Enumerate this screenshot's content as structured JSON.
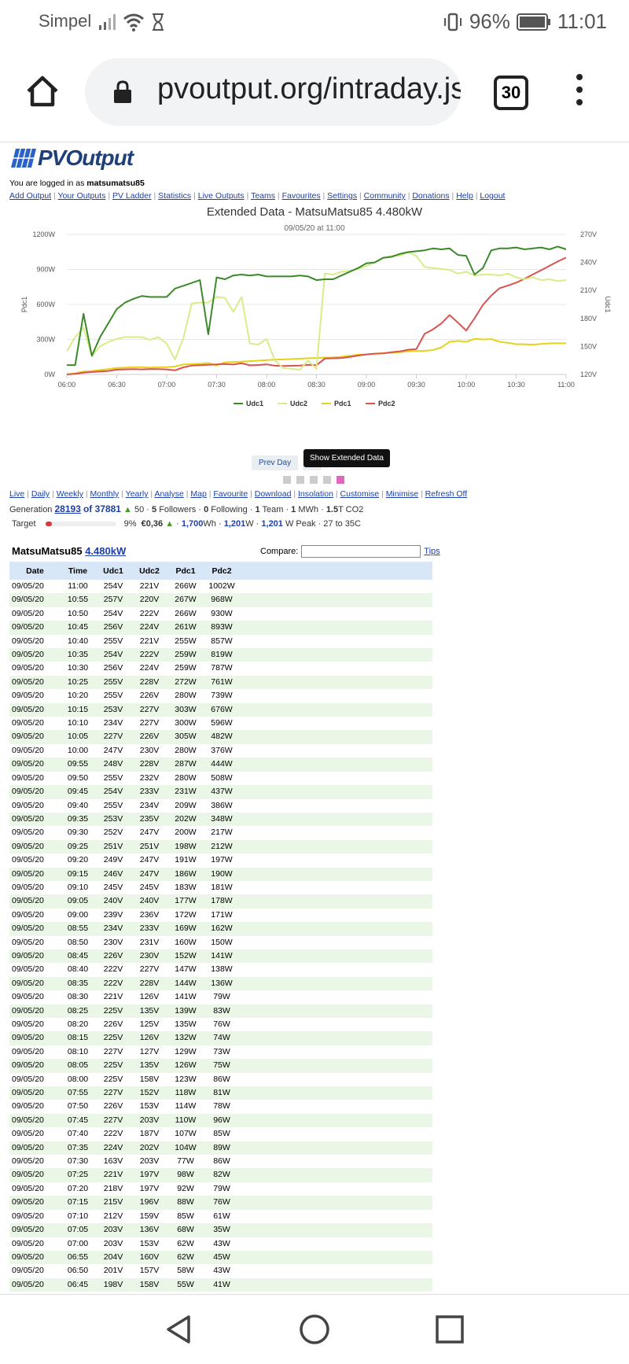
{
  "status": {
    "carrier": "Simpel",
    "battery": "96%",
    "time": "11:01"
  },
  "browser": {
    "url": "pvoutput.org/intraday.js",
    "tab_count": "30"
  },
  "site": {
    "logo": "PVOutput",
    "login_prefix": "You are logged in as",
    "username": "matsumatsu85",
    "nav": [
      "Add Output",
      "Your Outputs",
      "PV Ladder",
      "Statistics",
      "Live Outputs",
      "Teams",
      "Favourites",
      "Settings",
      "Community",
      "Donations",
      "Help",
      "Logout"
    ]
  },
  "chart_data": {
    "type": "line",
    "title": "Extended Data - MatsuMatsu85 4.480kW",
    "subtitle": "09/05/20 at 11:00",
    "ylabel": "Pdc1",
    "y2label": "Udc1",
    "ylim": [
      0,
      1200
    ],
    "y2lim": [
      120,
      270
    ],
    "yticks": [
      "0W",
      "300W",
      "600W",
      "900W",
      "1200W"
    ],
    "y2ticks": [
      "120V",
      "150V",
      "180V",
      "210V",
      "240V",
      "270V"
    ],
    "xticks": [
      "06:00",
      "06:30",
      "07:00",
      "07:30",
      "08:00",
      "08:30",
      "09:00",
      "09:30",
      "10:00",
      "10:30",
      "11:00"
    ],
    "grid": true,
    "legend_position": "bottom",
    "x": [
      "06:00",
      "06:05",
      "06:10",
      "06:15",
      "06:20",
      "06:25",
      "06:30",
      "06:35",
      "06:40",
      "06:45",
      "06:50",
      "06:55",
      "07:00",
      "07:05",
      "07:10",
      "07:15",
      "07:20",
      "07:25",
      "07:30",
      "07:35",
      "07:40",
      "07:45",
      "07:50",
      "07:55",
      "08:00",
      "08:05",
      "08:10",
      "08:15",
      "08:20",
      "08:25",
      "08:30",
      "08:35",
      "08:40",
      "08:45",
      "08:50",
      "08:55",
      "09:00",
      "09:05",
      "09:10",
      "09:15",
      "09:20",
      "09:25",
      "09:30",
      "09:35",
      "09:40",
      "09:45",
      "09:50",
      "09:55",
      "10:00",
      "10:05",
      "10:10",
      "10:15",
      "10:20",
      "10:25",
      "10:30",
      "10:35",
      "10:40",
      "10:45",
      "10:50",
      "10:55",
      "11:00"
    ],
    "series": [
      {
        "name": "Udc1",
        "axis": "right",
        "color": "#3b8a2a",
        "values": [
          130,
          130,
          185,
          140,
          160,
          175,
          190,
          197,
          201,
          204,
          203,
          203,
          203,
          212,
          215,
          218,
          221,
          163,
          224,
          222,
          226,
          227,
          226,
          227,
          225,
          225,
          225,
          225,
          226,
          225,
          221,
          222,
          222,
          226,
          230,
          234,
          239,
          240,
          245,
          246,
          249,
          251,
          252,
          253,
          255,
          254,
          255,
          248,
          247,
          227,
          234,
          253,
          255,
          255,
          256,
          254,
          255,
          256,
          254,
          257,
          254
        ]
      },
      {
        "name": "Udc2",
        "axis": "right",
        "color": "#d9ec8a",
        "values": [
          145,
          160,
          170,
          140,
          150,
          155,
          158,
          160,
          160,
          160,
          157,
          160,
          153,
          136,
          159,
          196,
          197,
          197,
          203,
          202,
          187,
          203,
          153,
          152,
          158,
          135,
          127,
          126,
          125,
          135,
          126,
          228,
          227,
          230,
          231,
          233,
          236,
          240,
          245,
          247,
          247,
          251,
          247,
          235,
          234,
          233,
          232,
          228,
          230,
          226,
          227,
          227,
          226,
          228,
          224,
          222,
          224,
          221,
          222,
          220,
          221
        ]
      },
      {
        "name": "Pdc1",
        "axis": "left",
        "color": "#e5d21a",
        "values": [
          0,
          10,
          25,
          30,
          38,
          45,
          55,
          58,
          62,
          62,
          58,
          62,
          62,
          68,
          85,
          88,
          92,
          98,
          77,
          104,
          107,
          110,
          114,
          118,
          123,
          126,
          129,
          132,
          135,
          139,
          141,
          144,
          147,
          152,
          160,
          169,
          172,
          177,
          183,
          186,
          191,
          198,
          200,
          202,
          209,
          231,
          280,
          287,
          280,
          305,
          300,
          303,
          280,
          272,
          259,
          259,
          255,
          261,
          266,
          267,
          266
        ]
      },
      {
        "name": "Pdc2",
        "axis": "left",
        "color": "#d9534f",
        "values": [
          0,
          5,
          15,
          20,
          25,
          30,
          41,
          43,
          45,
          43,
          45,
          45,
          43,
          35,
          61,
          76,
          79,
          82,
          86,
          89,
          85,
          96,
          78,
          81,
          86,
          75,
          73,
          74,
          76,
          83,
          79,
          136,
          138,
          141,
          150,
          162,
          171,
          178,
          181,
          190,
          197,
          212,
          217,
          348,
          386,
          437,
          508,
          444,
          376,
          482,
          596,
          676,
          739,
          761,
          787,
          819,
          857,
          893,
          930,
          968,
          1002
        ]
      }
    ]
  },
  "controls": {
    "prev_day": "Prev Day",
    "next_partial": "0",
    "tooltip": "Show Extended Data"
  },
  "chart_links": [
    "Live",
    "Daily",
    "Weekly",
    "Monthly",
    "Yearly",
    "Analyse",
    "Map",
    "Favourite",
    "Download",
    "Insolation",
    "Customise",
    "Minimise",
    "Refresh Off"
  ],
  "generation": {
    "label": "Generation",
    "rank": "28193",
    "total": "of 37881",
    "delta": "50",
    "followers": "5",
    "followers_label": "Followers",
    "following": "0",
    "following_label": "Following",
    "teams": "1",
    "teams_label": "Team",
    "mwh": "1",
    "mwh_label": "MWh",
    "co2": "1.5",
    "co2_label": "T CO2"
  },
  "target": {
    "label": "Target",
    "percent": "9%",
    "fraction": 0.09,
    "money": "€0,36",
    "wh": "1,700",
    "wh_unit": "Wh",
    "w": "1,201",
    "w_unit": "W",
    "peak": "1,201",
    "peak_unit": "W Peak",
    "temp": "27 to 35C"
  },
  "system": {
    "name": "MatsuMatsu85",
    "size": "4.480kW",
    "compare_label": "Compare:",
    "tips": "Tips"
  },
  "table": {
    "headers": [
      "Date",
      "Time",
      "Udc1",
      "Udc2",
      "Pdc1",
      "Pdc2"
    ],
    "rows": [
      [
        "09/05/20",
        "11:00",
        "254V",
        "221V",
        "266W",
        "1002W"
      ],
      [
        "09/05/20",
        "10:55",
        "257V",
        "220V",
        "267W",
        "968W"
      ],
      [
        "09/05/20",
        "10:50",
        "254V",
        "222V",
        "266W",
        "930W"
      ],
      [
        "09/05/20",
        "10:45",
        "256V",
        "224V",
        "261W",
        "893W"
      ],
      [
        "09/05/20",
        "10:40",
        "255V",
        "221V",
        "255W",
        "857W"
      ],
      [
        "09/05/20",
        "10:35",
        "254V",
        "222V",
        "259W",
        "819W"
      ],
      [
        "09/05/20",
        "10:30",
        "256V",
        "224V",
        "259W",
        "787W"
      ],
      [
        "09/05/20",
        "10:25",
        "255V",
        "228V",
        "272W",
        "761W"
      ],
      [
        "09/05/20",
        "10:20",
        "255V",
        "226V",
        "280W",
        "739W"
      ],
      [
        "09/05/20",
        "10:15",
        "253V",
        "227V",
        "303W",
        "676W"
      ],
      [
        "09/05/20",
        "10:10",
        "234V",
        "227V",
        "300W",
        "596W"
      ],
      [
        "09/05/20",
        "10:05",
        "227V",
        "226V",
        "305W",
        "482W"
      ],
      [
        "09/05/20",
        "10:00",
        "247V",
        "230V",
        "280W",
        "376W"
      ],
      [
        "09/05/20",
        "09:55",
        "248V",
        "228V",
        "287W",
        "444W"
      ],
      [
        "09/05/20",
        "09:50",
        "255V",
        "232V",
        "280W",
        "508W"
      ],
      [
        "09/05/20",
        "09:45",
        "254V",
        "233V",
        "231W",
        "437W"
      ],
      [
        "09/05/20",
        "09:40",
        "255V",
        "234V",
        "209W",
        "386W"
      ],
      [
        "09/05/20",
        "09:35",
        "253V",
        "235V",
        "202W",
        "348W"
      ],
      [
        "09/05/20",
        "09:30",
        "252V",
        "247V",
        "200W",
        "217W"
      ],
      [
        "09/05/20",
        "09:25",
        "251V",
        "251V",
        "198W",
        "212W"
      ],
      [
        "09/05/20",
        "09:20",
        "249V",
        "247V",
        "191W",
        "197W"
      ],
      [
        "09/05/20",
        "09:15",
        "246V",
        "247V",
        "186W",
        "190W"
      ],
      [
        "09/05/20",
        "09:10",
        "245V",
        "245V",
        "183W",
        "181W"
      ],
      [
        "09/05/20",
        "09:05",
        "240V",
        "240V",
        "177W",
        "178W"
      ],
      [
        "09/05/20",
        "09:00",
        "239V",
        "236V",
        "172W",
        "171W"
      ],
      [
        "09/05/20",
        "08:55",
        "234V",
        "233V",
        "169W",
        "162W"
      ],
      [
        "09/05/20",
        "08:50",
        "230V",
        "231V",
        "160W",
        "150W"
      ],
      [
        "09/05/20",
        "08:45",
        "226V",
        "230V",
        "152W",
        "141W"
      ],
      [
        "09/05/20",
        "08:40",
        "222V",
        "227V",
        "147W",
        "138W"
      ],
      [
        "09/05/20",
        "08:35",
        "222V",
        "228V",
        "144W",
        "136W"
      ],
      [
        "09/05/20",
        "08:30",
        "221V",
        "126V",
        "141W",
        "79W"
      ],
      [
        "09/05/20",
        "08:25",
        "225V",
        "135V",
        "139W",
        "83W"
      ],
      [
        "09/05/20",
        "08:20",
        "226V",
        "125V",
        "135W",
        "76W"
      ],
      [
        "09/05/20",
        "08:15",
        "225V",
        "126V",
        "132W",
        "74W"
      ],
      [
        "09/05/20",
        "08:10",
        "227V",
        "127V",
        "129W",
        "73W"
      ],
      [
        "09/05/20",
        "08:05",
        "225V",
        "135V",
        "126W",
        "75W"
      ],
      [
        "09/05/20",
        "08:00",
        "225V",
        "158V",
        "123W",
        "86W"
      ],
      [
        "09/05/20",
        "07:55",
        "227V",
        "152V",
        "118W",
        "81W"
      ],
      [
        "09/05/20",
        "07:50",
        "226V",
        "153V",
        "114W",
        "78W"
      ],
      [
        "09/05/20",
        "07:45",
        "227V",
        "203V",
        "110W",
        "96W"
      ],
      [
        "09/05/20",
        "07:40",
        "222V",
        "187V",
        "107W",
        "85W"
      ],
      [
        "09/05/20",
        "07:35",
        "224V",
        "202V",
        "104W",
        "89W"
      ],
      [
        "09/05/20",
        "07:30",
        "163V",
        "203V",
        "77W",
        "86W"
      ],
      [
        "09/05/20",
        "07:25",
        "221V",
        "197V",
        "98W",
        "82W"
      ],
      [
        "09/05/20",
        "07:20",
        "218V",
        "197V",
        "92W",
        "79W"
      ],
      [
        "09/05/20",
        "07:15",
        "215V",
        "196V",
        "88W",
        "76W"
      ],
      [
        "09/05/20",
        "07:10",
        "212V",
        "159V",
        "85W",
        "61W"
      ],
      [
        "09/05/20",
        "07:05",
        "203V",
        "136V",
        "68W",
        "35W"
      ],
      [
        "09/05/20",
        "07:00",
        "203V",
        "153V",
        "62W",
        "43W"
      ],
      [
        "09/05/20",
        "06:55",
        "204V",
        "160V",
        "62W",
        "45W"
      ],
      [
        "09/05/20",
        "06:50",
        "201V",
        "157V",
        "58W",
        "43W"
      ],
      [
        "09/05/20",
        "06:45",
        "198V",
        "158V",
        "55W",
        "41W"
      ]
    ]
  }
}
